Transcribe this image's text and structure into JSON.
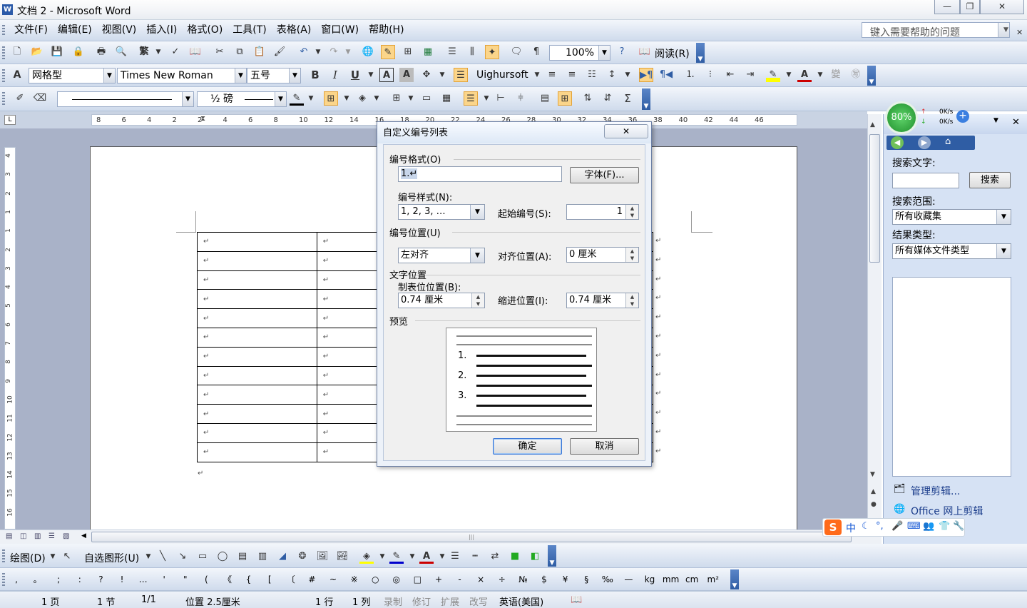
{
  "window": {
    "title": "文档 2 - Microsoft Word",
    "minimize": "—",
    "restore": "❐",
    "close": "✕"
  },
  "menu": {
    "items": [
      "文件(F)",
      "编辑(E)",
      "视图(V)",
      "插入(I)",
      "格式(O)",
      "工具(T)",
      "表格(A)",
      "窗口(W)",
      "帮助(H)"
    ],
    "help_placeholder": "键入需要帮助的问题"
  },
  "toolbar_standard": {
    "zoom": "100%",
    "read_label": "阅读(R)"
  },
  "toolbar_format": {
    "style": "网格型",
    "font": "Times New Roman",
    "size": "五号",
    "bidi_font": "Uighursoft"
  },
  "toolbar_tables": {
    "line_weight": "½ 磅"
  },
  "ruler": {
    "marks": [
      "8",
      "6",
      "4",
      "2",
      "2",
      "4",
      "6",
      "8",
      "10",
      "12",
      "14",
      "16",
      "18",
      "20",
      "22",
      "24",
      "26",
      "28",
      "30",
      "32",
      "34",
      "36",
      "38",
      "40",
      "42",
      "44",
      "46"
    ]
  },
  "vruler": {
    "marks": [
      "4",
      "3",
      "2",
      "1",
      "1",
      "2",
      "3",
      "4",
      "5",
      "6",
      "7",
      "8",
      "9",
      "10",
      "11",
      "12",
      "13",
      "14",
      "15",
      "16"
    ]
  },
  "document": {
    "cell_mark": "↵",
    "rows": 12
  },
  "dialog": {
    "title": "自定义编号列表",
    "close": "✕",
    "number_format_label": "编号格式(O)",
    "number_format_value": "1.↵",
    "font_button": "字体(F)...",
    "number_style_label": "编号样式(N):",
    "number_style_value": "1, 2, 3, …",
    "start_at_label": "起始编号(S):",
    "start_at_value": "1",
    "number_position_label": "编号位置(U)",
    "alignment_value": "左对齐",
    "aligned_at_label": "对齐位置(A):",
    "aligned_at_value": "0 厘米",
    "text_position_label": "文字位置",
    "tab_stop_label": "制表位位置(B):",
    "tab_stop_value": "0.74 厘米",
    "indent_label": "缩进位置(I):",
    "indent_value": "0.74 厘米",
    "preview_label": "预览",
    "preview_numbers": [
      "1.",
      "2.",
      "3."
    ],
    "ok_button": "确定",
    "cancel_button": "取消"
  },
  "task_pane": {
    "badge": "80%",
    "speed_up": "0K/s",
    "speed_down": "0K/s",
    "search_text_label": "搜索文字:",
    "search_button": "搜索",
    "search_in_label": "搜索范围:",
    "search_in_value": "所有收藏集",
    "result_type_label": "结果类型:",
    "result_type_value": "所有媒体文件类型",
    "organize_link": "管理剪辑...",
    "online_link": "Office 网上剪辑"
  },
  "ime": {
    "lang": "中"
  },
  "toolbar_drawing": {
    "draw_label": "绘图(D)",
    "autoshapes_label": "自选图形(U)"
  },
  "symbols": [
    ",",
    "。",
    ";",
    ":",
    "?",
    "!",
    "…",
    "'",
    "\"",
    "(",
    "《",
    "{",
    "[",
    "〔",
    "#",
    "~",
    "※",
    "○",
    "◎",
    "□",
    "+",
    "-",
    "×",
    "÷",
    "№",
    "$",
    "¥",
    "§",
    "‰",
    "—",
    "kg",
    "mm",
    "cm",
    "m²"
  ],
  "status": {
    "page": "1 页",
    "section": "1 节",
    "pages": "1/1",
    "position": "位置 2.5厘米",
    "line": "1 行",
    "col": "1 列",
    "rec": "录制",
    "trk": "修订",
    "ext": "扩展",
    "ovr": "改写",
    "lang": "英语(美国)"
  },
  "colors": {
    "accent": "#2f5da4",
    "dialog_bg": "#f0f0f0",
    "doc_bg": "#a9b2c8"
  }
}
